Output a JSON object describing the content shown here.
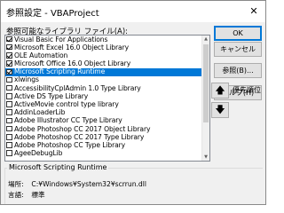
{
  "window": {
    "title": "参照設定 - VBAProject",
    "close_glyph": "✕"
  },
  "references": {
    "label": "参照可能なライブラリ ファイル(A):",
    "items": [
      {
        "label": "Visual Basic For Applications",
        "checked": true,
        "selected": false
      },
      {
        "label": "Microsoft Excel 16.0 Object Library",
        "checked": true,
        "selected": false
      },
      {
        "label": "OLE Automation",
        "checked": true,
        "selected": false
      },
      {
        "label": "Microsoft Office 16.0 Object Library",
        "checked": true,
        "selected": false
      },
      {
        "label": "Microsoft Scripting Runtime",
        "checked": true,
        "selected": true
      },
      {
        "label": "xlwings",
        "checked": false,
        "selected": false
      },
      {
        "label": "AccessibilityCplAdmin 1.0 Type Library",
        "checked": false,
        "selected": false
      },
      {
        "label": "Active DS Type Library",
        "checked": false,
        "selected": false
      },
      {
        "label": "ActiveMovie control type library",
        "checked": false,
        "selected": false
      },
      {
        "label": "AddinLoaderLib",
        "checked": false,
        "selected": false
      },
      {
        "label": "Adobe Illustrator CC Type Library",
        "checked": false,
        "selected": false
      },
      {
        "label": "Adobe Photoshop CC 2017 Object Library",
        "checked": false,
        "selected": false
      },
      {
        "label": "Adobe Photoshop CC 2017 Type Library",
        "checked": false,
        "selected": false
      },
      {
        "label": "Adobe Photoshop CC Type Library",
        "checked": false,
        "selected": false
      },
      {
        "label": "AgeeDebugLib",
        "checked": false,
        "selected": false
      }
    ]
  },
  "buttons": {
    "ok": "OK",
    "cancel": "キャンセル",
    "browse": "参照(B)...",
    "help": "ヘルプ(H)"
  },
  "priority": {
    "label": "優先順位",
    "up_glyph": "🡅",
    "down_glyph": "🡇"
  },
  "info": {
    "title": "Microsoft Scripting Runtime",
    "location_label": "場所:",
    "location_value": "C:¥Windows¥System32¥scrrun.dll",
    "language_label": "言語:",
    "language_value": "標準"
  },
  "colors": {
    "selection": "#0078d7",
    "dialog_bg": "#f0f0f0"
  }
}
